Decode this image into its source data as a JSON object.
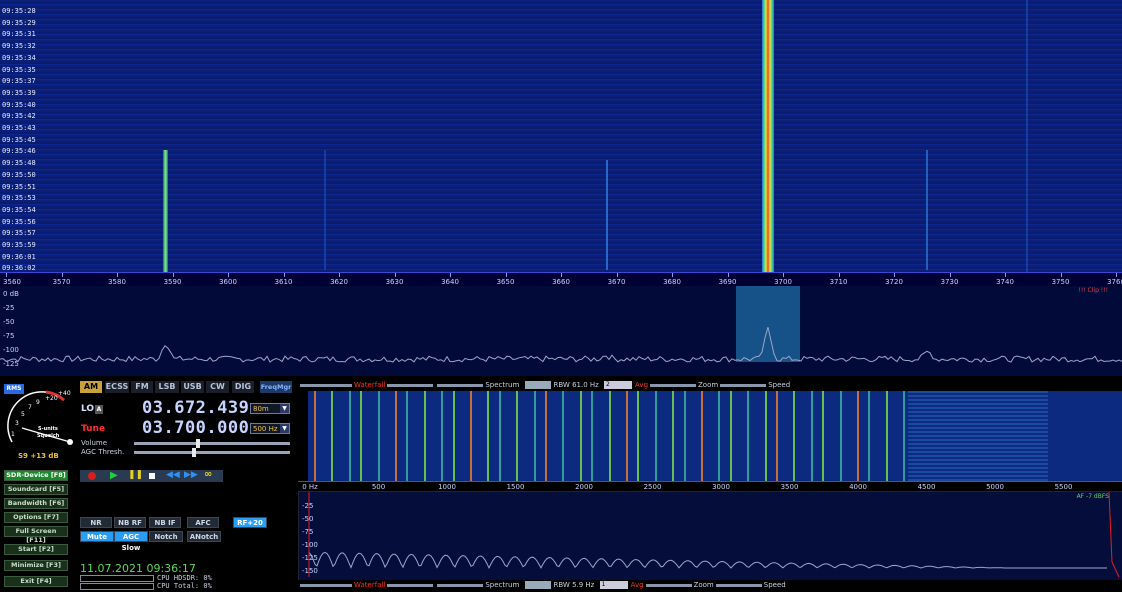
{
  "waterfall": {
    "timestamps": [
      "09:35:28",
      "09:35:29",
      "09:35:31",
      "09:35:32",
      "09:35:34",
      "09:35:35",
      "09:35:37",
      "09:35:39",
      "09:35:40",
      "09:35:42",
      "09:35:43",
      "09:35:45",
      "09:35:46",
      "09:35:48",
      "09:35:50",
      "09:35:51",
      "09:35:53",
      "09:35:54",
      "09:35:56",
      "09:35:57",
      "09:35:59",
      "09:36:01",
      "09:36:02"
    ],
    "freq_ticks": [
      "3560",
      "3570",
      "3580",
      "3590",
      "3600",
      "3610",
      "3620",
      "3630",
      "3640",
      "3650",
      "3660",
      "3670",
      "3680",
      "3690",
      "3700",
      "3710",
      "3720",
      "3730",
      "3740",
      "3750",
      "3760"
    ]
  },
  "spectrum": {
    "db_labels": [
      "0 dB",
      "-25",
      "-50",
      "-75",
      "-100",
      "-125"
    ],
    "clip_label": "!!! Clip !!!"
  },
  "smeter": {
    "mode_label": "RMS",
    "scale": [
      "1",
      "3",
      "5",
      "7",
      "9",
      "+20",
      "+40"
    ],
    "units_label": "S-units",
    "squelch_label": "Squelch",
    "reading": "S9 +13 dB"
  },
  "modes": [
    "AM",
    "ECSS",
    "FM",
    "LSB",
    "USB",
    "CW",
    "DIG"
  ],
  "freqmgr_label": "FreqMgr",
  "lo": {
    "label": "LO",
    "badge": "A",
    "value": "03.672.439",
    "band": "80m"
  },
  "tune": {
    "label": "Tune",
    "value": "03.700.000",
    "step": "500 Hz"
  },
  "sliders": {
    "volume": "Volume",
    "agc": "AGC Thresh."
  },
  "side_buttons": [
    "SDR-Device [F8]",
    "Soundcard [F5]",
    "Bandwidth [F6]",
    "Options [F7]",
    "Full Screen [F11]",
    "Start [F2]",
    "Minimize [F3]",
    "Exit [F4]"
  ],
  "dsp_row1": [
    "NR",
    "NB RF",
    "NB IF",
    "AFC",
    "RF+20"
  ],
  "dsp_row2": [
    "Mute",
    "AGC Slow",
    "Notch",
    "ANotch"
  ],
  "datetime": "11.07.2021 09:36:17",
  "cpu": {
    "hdsdr": "CPU HDSDR: 0%",
    "total": "CPU Total: 0%"
  },
  "toolbar_top": {
    "waterfall": "Waterfall",
    "spectrum": "Spectrum",
    "rbw": "RBW 61.0 Hz",
    "avg_value": "2",
    "avg": "Avg",
    "zoom": "Zoom",
    "speed": "Speed"
  },
  "af_ticks": [
    "0 Hz",
    "500",
    "1000",
    "1500",
    "2000",
    "2500",
    "3000",
    "3500",
    "4000",
    "4500",
    "5000",
    "5500"
  ],
  "af_db": [
    "-25",
    "-50",
    "-75",
    "-100",
    "-125",
    "-150"
  ],
  "af_label": "AF -7 dBFS",
  "toolbar_bottom": {
    "waterfall": "Waterfall",
    "spectrum": "Spectrum",
    "rbw": "RBW 5.9 Hz",
    "avg_value": "1",
    "avg": "Avg",
    "zoom": "Zoom",
    "speed": "Speed"
  },
  "colors": {
    "accent": "#2a9df4",
    "mode_on": "#c9a13a",
    "tune_red": "#ff3030",
    "date_green": "#5ad85a"
  }
}
